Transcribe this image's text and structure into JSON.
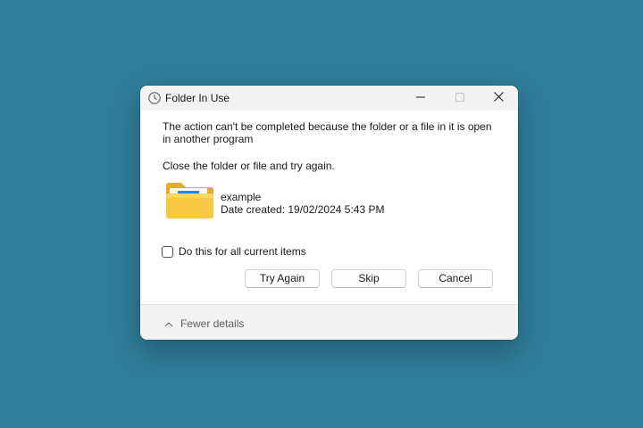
{
  "window": {
    "title": "Folder In Use",
    "title_icon": "clock-icon"
  },
  "message": {
    "text": "The action can't be completed because the folder or a file in it is open in another program",
    "instruction": "Close the folder or file and try again."
  },
  "file": {
    "icon": "folder-icon",
    "name": "example",
    "date_created": "Date created: 19/02/2024 5:43 PM"
  },
  "checkbox": {
    "label": "Do this for all current items",
    "checked": false
  },
  "buttons": {
    "try_again": "Try Again",
    "skip": "Skip",
    "cancel": "Cancel"
  },
  "footer": {
    "details_label": "Fewer details",
    "details_icon": "chevron-up-icon"
  },
  "colors": {
    "desktop": "#2f7d9b",
    "dialog": "#ffffff",
    "titlebar": "#f3f3f3",
    "folder_yellow": "#f7c844",
    "folder_accent": "#1e88e5"
  }
}
